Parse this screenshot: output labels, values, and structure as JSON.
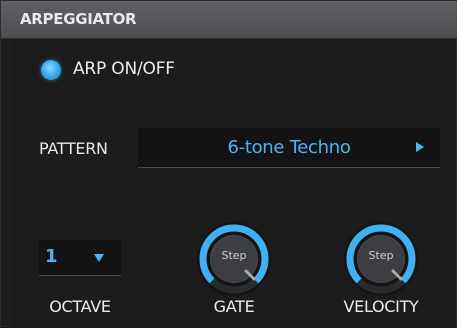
{
  "panel": {
    "title": "ARPEGGIATOR"
  },
  "arp": {
    "label": "ARP ON/OFF",
    "on": true
  },
  "pattern": {
    "label": "PATTERN",
    "value": "6-tone Techno"
  },
  "octave": {
    "label": "OCTAVE",
    "value": "1"
  },
  "gate": {
    "label": "GATE",
    "value_label": "Step"
  },
  "velocity": {
    "label": "VELOCITY",
    "value_label": "Step"
  },
  "colors": {
    "accent": "#47b6f6",
    "text": "#ececec",
    "background": "#1e1e1e",
    "title_bar": "#55565a"
  }
}
